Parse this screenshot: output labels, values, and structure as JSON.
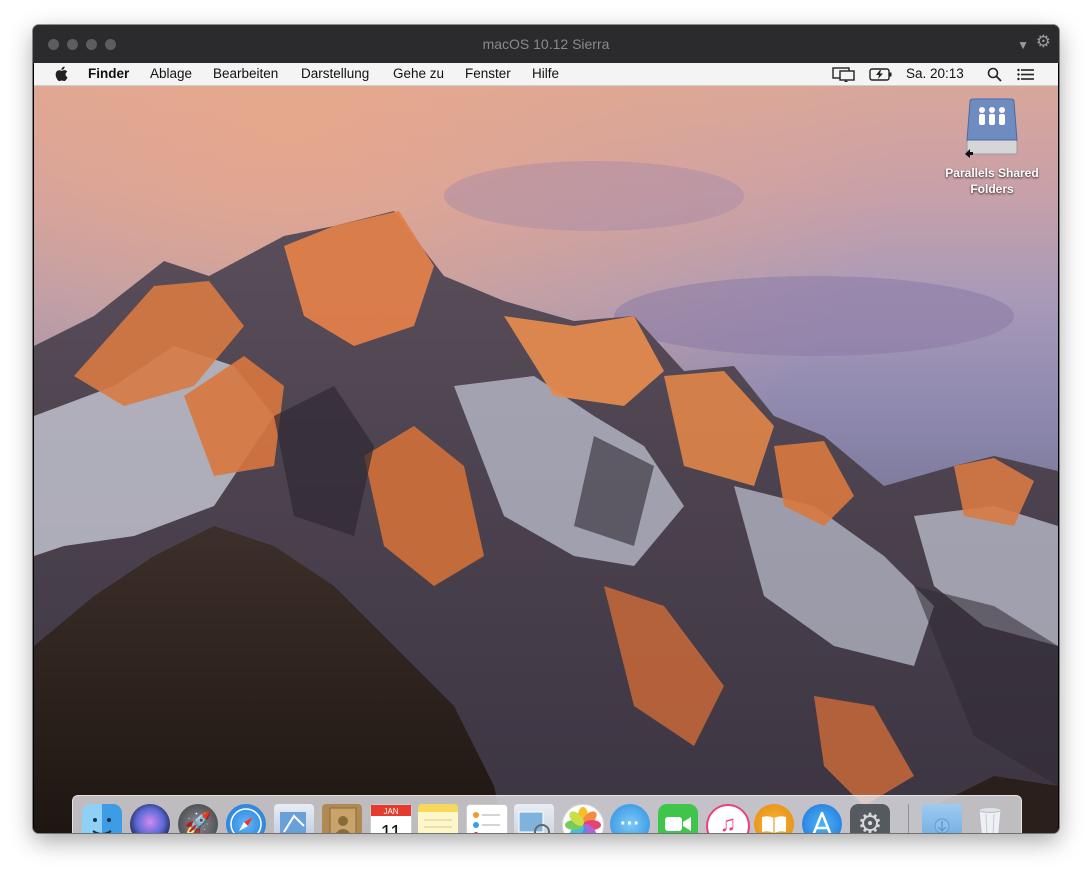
{
  "window": {
    "title": "macOS 10.12 Sierra"
  },
  "menubar": {
    "apple_icon": "apple-logo-icon",
    "items": [
      "Finder",
      "Ablage",
      "Bearbeiten",
      "Darstellung",
      "Gehe zu",
      "Fenster",
      "Hilfe"
    ],
    "status_icons": [
      "display-icon",
      "battery-charging-icon",
      "spotlight-search-icon",
      "notification-center-icon"
    ],
    "clock": "Sa. 20:13"
  },
  "desktop": {
    "icons": [
      {
        "name": "parallels-shared-folders-icon",
        "label": "Parallels Shared Folders"
      }
    ]
  },
  "dock": {
    "apps": [
      {
        "name": "finder-icon",
        "running": true
      },
      {
        "name": "siri-icon"
      },
      {
        "name": "launchpad-icon"
      },
      {
        "name": "safari-icon"
      },
      {
        "name": "mail-icon"
      },
      {
        "name": "contacts-icon"
      },
      {
        "name": "calendar-icon",
        "month": "JAN",
        "day": "11"
      },
      {
        "name": "notes-icon"
      },
      {
        "name": "reminders-icon"
      },
      {
        "name": "preview-icon"
      },
      {
        "name": "photos-icon"
      },
      {
        "name": "messages-icon"
      },
      {
        "name": "facetime-icon"
      },
      {
        "name": "itunes-icon"
      },
      {
        "name": "ibooks-icon"
      },
      {
        "name": "app-store-icon"
      },
      {
        "name": "system-preferences-icon"
      },
      {
        "name": "downloads-folder-icon"
      },
      {
        "name": "trash-icon"
      }
    ]
  },
  "colors": {
    "titlebar": "#2b2b2d",
    "menubar": "#f4f4f4",
    "wallpaper_sky": "#978fb3",
    "peak_glow": "#e0804a"
  }
}
